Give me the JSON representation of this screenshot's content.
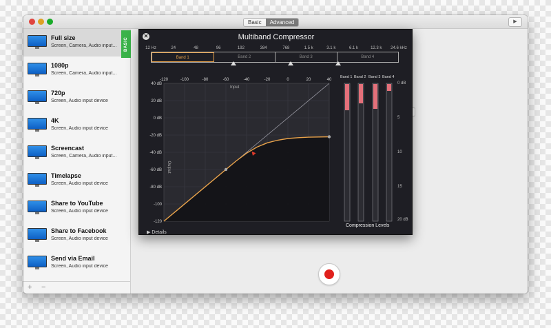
{
  "window": {
    "mode_tabs": [
      "Basic",
      "Advanced"
    ],
    "active_tab": "Advanced",
    "play_icon": "play-icon"
  },
  "sidebar": {
    "basic_tag": "BASIC",
    "presets": [
      {
        "title": "Full size",
        "subtitle": "Screen, Camera, Audio input..."
      },
      {
        "title": "1080p",
        "subtitle": "Screen, Camera, Audio input..."
      },
      {
        "title": "720p",
        "subtitle": "Screen, Audio input device"
      },
      {
        "title": "4K",
        "subtitle": "Screen, Audio input device"
      },
      {
        "title": "Screencast",
        "subtitle": "Screen, Camera, Audio input..."
      },
      {
        "title": "Timelapse",
        "subtitle": "Screen, Audio input device"
      },
      {
        "title": "Share to YouTube",
        "subtitle": "Screen, Audio input device"
      },
      {
        "title": "Share to Facebook",
        "subtitle": "Screen, Audio input device"
      },
      {
        "title": "Send via Email",
        "subtitle": "Screen, Audio input device"
      }
    ],
    "add_label": "+",
    "remove_label": "−"
  },
  "main": {
    "channels_label": "hannels"
  },
  "compressor": {
    "title": "Multiband Compressor",
    "close_label": "✕",
    "freq_labels": [
      "12 Hz",
      "24",
      "48",
      "96",
      "192",
      "384",
      "768",
      "1.5 k",
      "3.1 k",
      "6.1 k",
      "12.3 k",
      "24.6 kHz"
    ],
    "bands": [
      "Band 1",
      "Band 2",
      "Band 3",
      "Band 4"
    ],
    "active_band": 0,
    "accent_color": "#e8a24a",
    "graph": {
      "input_label": "Input",
      "output_label": "Output",
      "x_ticks": [
        "-120",
        "-100",
        "-80",
        "-60",
        "-40",
        "-20",
        "0",
        "20",
        "40"
      ],
      "y_ticks": [
        "40 dB",
        "20 dB",
        "0 dB",
        "-20 dB",
        "-40 dB",
        "-60 dB",
        "-80 dB",
        "-100",
        "-120"
      ],
      "x_range": [
        -120,
        40
      ],
      "y_range": [
        -120,
        40
      ]
    },
    "meters": {
      "labels": [
        "Band 1",
        "Band 2",
        "Band 3",
        "Band 4"
      ],
      "levels": [
        0.19,
        0.14,
        0.18,
        0.05
      ],
      "scale": [
        "0 dB",
        "5",
        "10",
        "15",
        "20 dB"
      ],
      "caption": "Compression Levels"
    },
    "details_label": "Details"
  }
}
